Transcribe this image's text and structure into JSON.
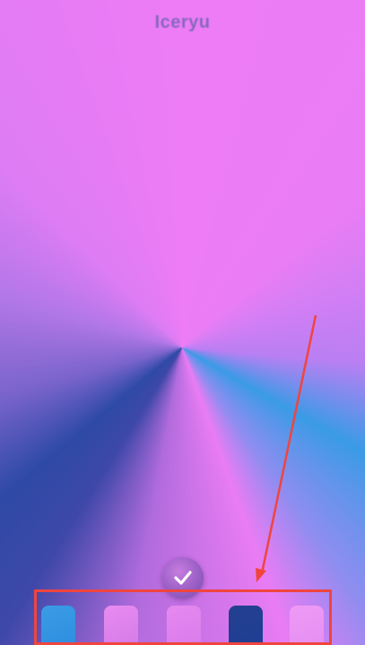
{
  "app": {
    "title": "Iceryu"
  },
  "apply_button": {
    "icon": "checkmark-icon"
  },
  "swatches": [
    {
      "name": "blue",
      "color": "#2f8fe0",
      "color2": "#3a9be6"
    },
    {
      "name": "pink",
      "color": "#d67ae8",
      "color2": "#e88cf1"
    },
    {
      "name": "pink-2",
      "color": "#da7beb",
      "color2": "#e58af0"
    },
    {
      "name": "navy",
      "color": "#1f3f95",
      "color2": "#243f8f"
    },
    {
      "name": "light-pink",
      "color": "#e58ff2",
      "color2": "#ef9af6"
    }
  ],
  "annotation": {
    "highlight_color": "#f0453f"
  }
}
